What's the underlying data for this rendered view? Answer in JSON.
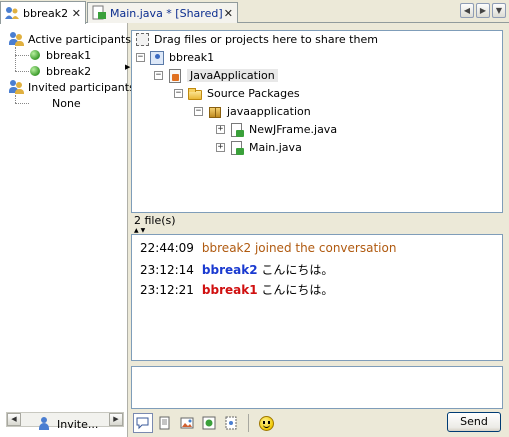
{
  "tabs": [
    {
      "label": "bbreak2",
      "close": "✕",
      "active": true
    },
    {
      "label": "Main.java * [Shared]",
      "close": "✕",
      "active": false
    }
  ],
  "nav": {
    "left": "◀",
    "right": "▶",
    "menu": "▼"
  },
  "participants": {
    "active_label": "Active participants",
    "active": [
      "bbreak1",
      "bbreak2"
    ],
    "invited_label": "Invited participants",
    "invited": [
      "None"
    ],
    "invite_button": "Invite..."
  },
  "share": {
    "hint": "Drag files or projects here to share them",
    "tree": {
      "user": "bbreak1",
      "project": "JavaApplication",
      "source": "Source Packages",
      "package": "javaapplication",
      "files": [
        "NewJFrame.java",
        "Main.java"
      ]
    },
    "file_count": "2 file(s)"
  },
  "chat": {
    "messages": [
      {
        "time": "22:44:09",
        "user": "",
        "text": "bbreak2 joined the conversation"
      },
      {
        "time": "23:12:14",
        "user": "bbreak2",
        "text": "こんにちは。"
      },
      {
        "time": "23:12:21",
        "user": "bbreak1",
        "text": "こんにちは。"
      }
    ],
    "input_value": "",
    "send_label": "Send"
  },
  "toolbar_icons": [
    "chat-icon",
    "document-icon",
    "image-icon",
    "module-icon",
    "notes-icon",
    "smiley-icon"
  ],
  "colors": {
    "system_message": "#b05a10",
    "bbreak2": "#1a3ad0",
    "bbreak1": "#d01010",
    "border": "#7f9db9"
  }
}
